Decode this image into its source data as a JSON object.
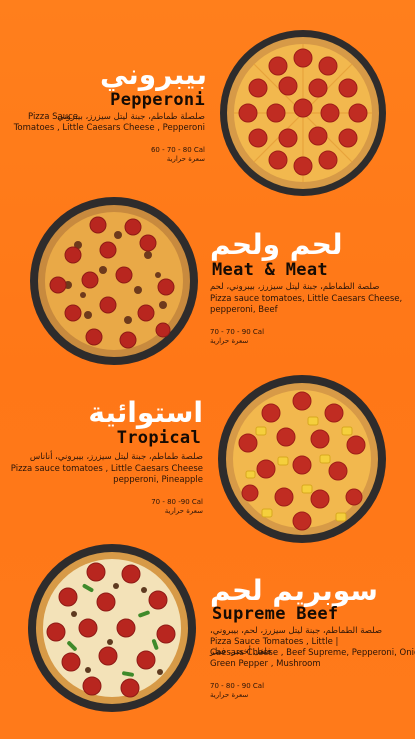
{
  "menu": {
    "items": [
      {
        "ar_name": "بيبروني",
        "en_name": "Pepperoni",
        "ar_desc": "صلصلة طماطم، جبنة ليتل سيزرز، بيبروني",
        "en_desc_lines": [
          "Pizza Sauce",
          "Tomatoes , Little Caesars Cheese , Pepperoni"
        ],
        "calories": "60 - 70 - 80 Cal",
        "ar_calories": "سعرة حرارية",
        "pizza_style": "pepperoni-icon"
      },
      {
        "ar_name": "لحم ولحم",
        "en_name": "Meat & Meat",
        "ar_desc": "صلصة الطماطم، جبنة ليتل سيزرز، بيبروني، لحم",
        "en_desc_lines": [
          "Pizza sauce tomatoes, Little Caesars Cheese,",
          "pepperoni, Beef"
        ],
        "calories": "70 - 70 - 90 Cal",
        "ar_calories": "سعرة حرارية",
        "pizza_style": "meat-icon"
      },
      {
        "ar_name": "استوائية",
        "en_name": "Tropical",
        "ar_desc": "صلصة طماطم، جبنة ليتل سيزرز، بيبروني، أناناس",
        "en_desc_lines": [
          "Pizza sauce tomatoes ,  Little Caesars Cheese",
          "pepperoni, Pineapple"
        ],
        "calories": "70 - 80 -90 Cal",
        "ar_calories": "سعرة حرارية",
        "pizza_style": "tropical-icon"
      },
      {
        "ar_name": "سوبريم لحم",
        "en_name": "Supreme Beef",
        "ar_desc_lines": [
          "صلصة الطماطم، جبنة ليتل سيزرز، لحم، بيبروني،",
          "فلفل أخضر، فطر"
        ],
        "en_desc_lines": [
          "Pizza Sauce Tomatoes , Little |",
          "Caesars Cheese , Beef Supreme, Pepperoni, Onions",
          "Green Pepper , Mushroom"
        ],
        "calories": "70 - 80 - 90 Cal",
        "ar_calories": "سعرة حرارية",
        "pizza_style": "supreme-icon"
      }
    ]
  },
  "colors": {
    "background": "#ff7a1a",
    "title_ar": "#ffffff",
    "title_en": "#150b04",
    "crust": "#d79a47",
    "cheese": "#f0b54a",
    "pepperoni": "#b8231e",
    "pan": "#2e2c2c"
  }
}
